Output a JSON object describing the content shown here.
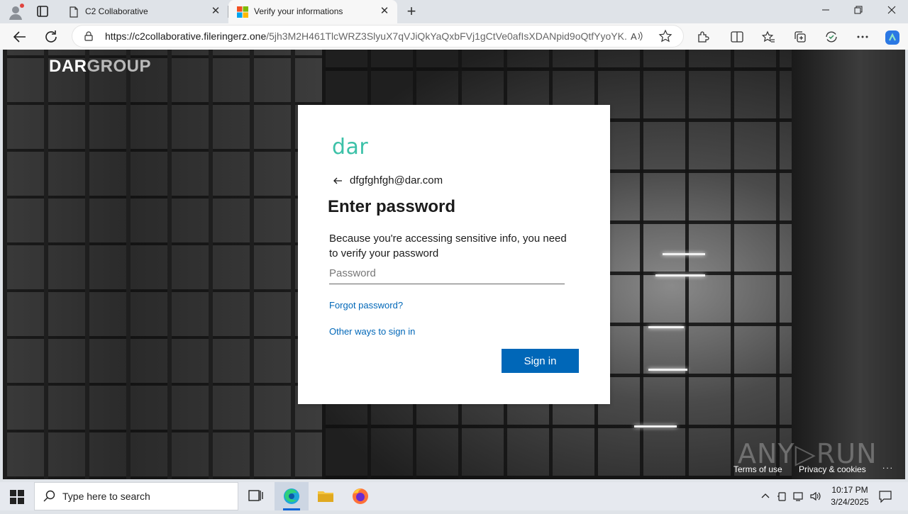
{
  "browser": {
    "tabs": [
      {
        "title": "C2 Collaborative"
      },
      {
        "title": "Verify your informations"
      }
    ],
    "address": {
      "url_domain": "https://c2collaborative.fileringerz.one",
      "url_path": "/5jh3M2H461TlcWRZ3SlyuX7qVJiQkYaQxbFVj1gCtVe0afIsXDANpid9oQtfYyoYK..."
    },
    "read_aloud_label": "A̅"
  },
  "page": {
    "brand_logo": {
      "part1": "DAR",
      "part2": "GROUP"
    },
    "card": {
      "brand": "dar",
      "identity": "dfgfghfgh@dar.com",
      "heading": "Enter password",
      "description": "Because you're accessing sensitive info, you need to verify your password",
      "password_placeholder": "Password",
      "forgot_link": "Forgot password?",
      "other_ways_link": "Other ways to sign in",
      "signin_button": "Sign in"
    },
    "footer": {
      "terms": "Terms of use",
      "privacy": "Privacy & cookies",
      "more": "..."
    },
    "watermark": "ANY▷RUN",
    "colors": {
      "accent": "#0067b8",
      "brand": "#3cc1a8"
    }
  },
  "taskbar": {
    "search_placeholder": "Type here to search",
    "time": "10:17 PM",
    "date": "3/24/2025"
  }
}
